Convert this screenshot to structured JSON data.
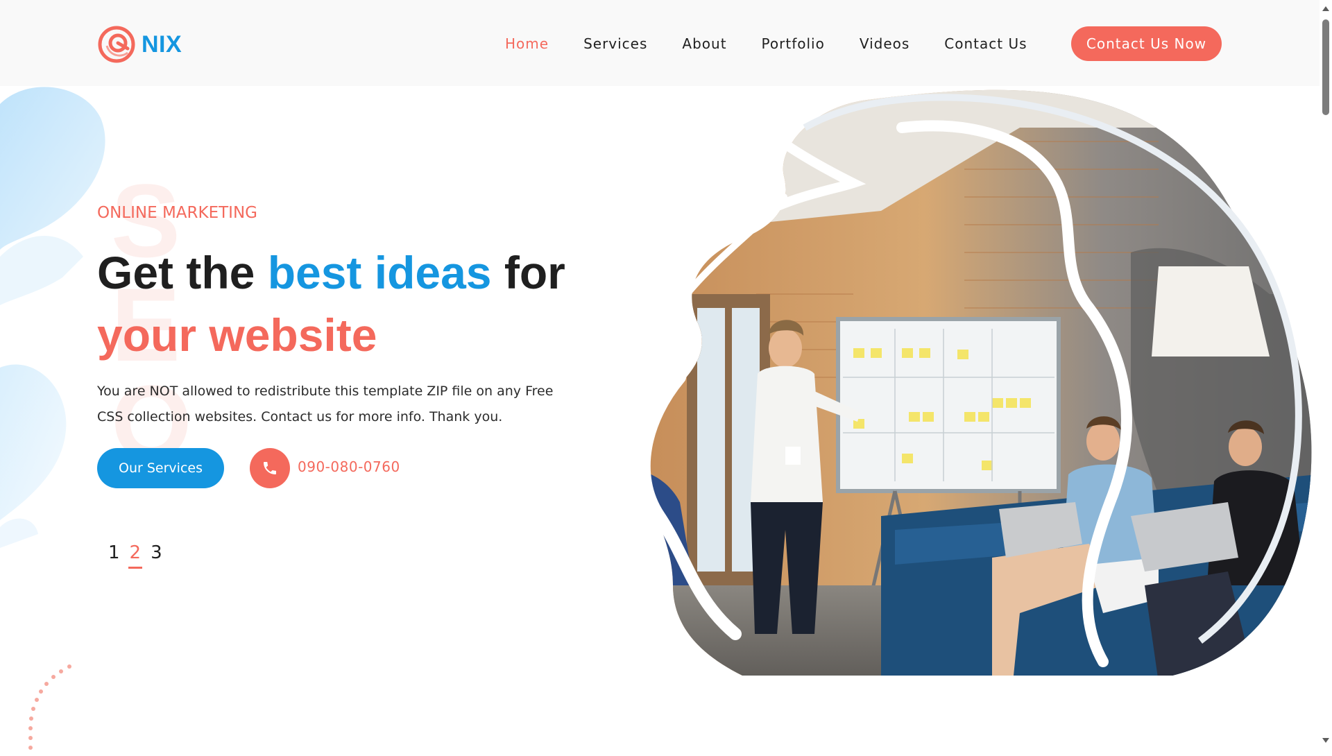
{
  "brand": {
    "name": "NIX"
  },
  "nav": {
    "items": [
      {
        "label": "Home",
        "active": true
      },
      {
        "label": "Services",
        "active": false
      },
      {
        "label": "About",
        "active": false
      },
      {
        "label": "Portfolio",
        "active": false
      },
      {
        "label": "Videos",
        "active": false
      },
      {
        "label": "Contact Us",
        "active": false
      }
    ],
    "cta_label": "Contact Us Now"
  },
  "hero": {
    "eyebrow": "ONLINE MARKETING",
    "title_part1": "Get the ",
    "title_highlight_blue": "best ideas",
    "title_part2": " for",
    "title_highlight_coral": "your website",
    "description": "You are NOT allowed to redistribute this template ZIP file on any Free CSS collection websites. Contact us for more info. Thank you.",
    "primary_button": "Our Services",
    "phone": "090-080-0760",
    "background_letters": "SEO"
  },
  "slider": {
    "pages": [
      "1",
      "2",
      "3"
    ],
    "active_index": 1
  },
  "colors": {
    "accent": "#f4695c",
    "brand_blue": "#1596e0",
    "text_dark": "#1f1f1f",
    "header_bg": "#f9f9f9"
  },
  "icons": {
    "logo": "nix-logo-icon",
    "phone": "phone-icon"
  }
}
